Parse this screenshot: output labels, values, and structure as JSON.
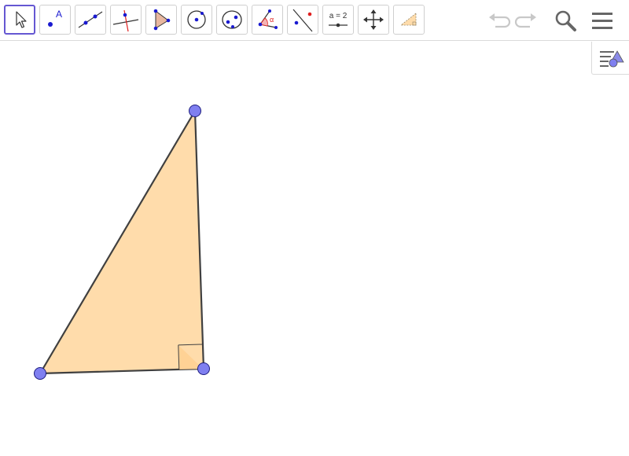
{
  "app": {
    "toolbar": {
      "tools": [
        {
          "name": "move-tool-button",
          "icon": "arrow-cursor-icon",
          "selected": true
        },
        {
          "name": "point-tool-button",
          "icon": "point-icon",
          "point_label": "A"
        },
        {
          "name": "line-tool-button",
          "icon": "line-through-two-points-icon"
        },
        {
          "name": "perpendicular-line-tool-button",
          "icon": "perpendicular-line-icon"
        },
        {
          "name": "polygon-tool-button",
          "icon": "polygon-icon"
        },
        {
          "name": "circle-tool-button",
          "icon": "circle-with-center-icon"
        },
        {
          "name": "conic-tool-button",
          "icon": "ellipse-icon"
        },
        {
          "name": "angle-tool-button",
          "icon": "angle-icon",
          "angle_symbol": "α"
        },
        {
          "name": "reflect-tool-button",
          "icon": "reflect-about-line-icon"
        },
        {
          "name": "slider-tool-button",
          "icon": "slider-icon",
          "label": "a = 2"
        },
        {
          "name": "move-graphics-view-tool-button",
          "icon": "move-graphics-view-icon"
        },
        {
          "name": "custom-tool-button",
          "icon": "triangle-tool-icon"
        }
      ],
      "undo_icon": "undo-icon",
      "redo_icon": "redo-icon",
      "search_icon": "search-icon",
      "menu_icon": "hamburger-menu-icon"
    },
    "style_bar_toggle_icon": "style-bar-toggle-icon"
  },
  "colors": {
    "accent": "#6557d2",
    "point_fill": "#7f7ff0",
    "polygon_fill": "#ffdcab",
    "segment_stroke": "#404040",
    "icon_blue": "#1a1ad0",
    "icon_red": "#e02020"
  },
  "construction": {
    "points": [
      {
        "name": "point-top"
      },
      {
        "name": "point-left"
      },
      {
        "name": "point-right"
      }
    ],
    "polygon": {
      "name": "triangle",
      "right_angle_at": "point-right"
    }
  }
}
